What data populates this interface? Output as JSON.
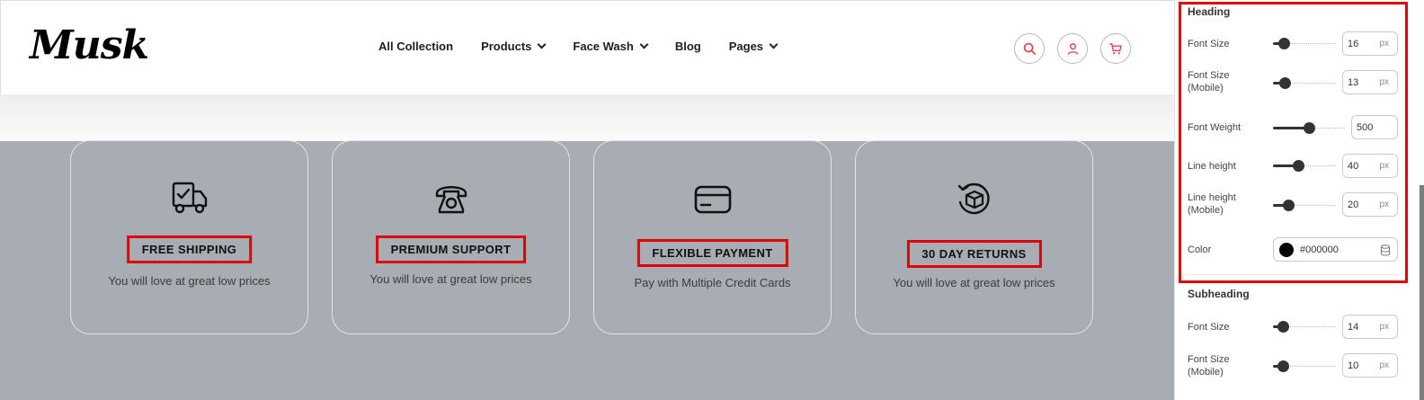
{
  "header": {
    "logo": "Musk",
    "nav": [
      {
        "label": "All Collection",
        "dropdown": false
      },
      {
        "label": "Products",
        "dropdown": true
      },
      {
        "label": "Face Wash",
        "dropdown": true
      },
      {
        "label": "Blog",
        "dropdown": false
      },
      {
        "label": "Pages",
        "dropdown": true
      }
    ],
    "icons": [
      "search-icon",
      "user-icon",
      "cart-icon"
    ],
    "icon_color": "#d9474f"
  },
  "features": [
    {
      "icon": "truck-icon",
      "title": "FREE SHIPPING",
      "subtitle": "You will love at great low prices"
    },
    {
      "icon": "phone-icon",
      "title": "PREMIUM SUPPORT",
      "subtitle": "You will love at great low prices"
    },
    {
      "icon": "credit-card-icon",
      "title": "FLEXIBLE PAYMENT",
      "subtitle": "Pay with Multiple Credit Cards"
    },
    {
      "icon": "return-box-icon",
      "title": "30 DAY RETURNS",
      "subtitle": "You will love at great low prices"
    }
  ],
  "panel": {
    "heading": {
      "title": "Heading",
      "font_size": {
        "label": "Font Size",
        "value": "16",
        "unit": "px"
      },
      "font_size_mobile": {
        "label": "Font Size (Mobile)",
        "value": "13",
        "unit": "px"
      },
      "font_weight": {
        "label": "Font Weight",
        "value": "500"
      },
      "line_height": {
        "label": "Line height",
        "value": "40",
        "unit": "px"
      },
      "line_height_mobile": {
        "label": "Line height (Mobile)",
        "value": "20",
        "unit": "px"
      },
      "color": {
        "label": "Color",
        "value": "#000000"
      }
    },
    "subheading": {
      "title": "Subheading",
      "font_size": {
        "label": "Font Size",
        "value": "14",
        "unit": "px"
      },
      "font_size_mobile": {
        "label": "Font Size (Mobile)",
        "value": "10",
        "unit": "px"
      }
    }
  },
  "colors": {
    "highlight": "#e00000",
    "preview_bg": "#a7adb2"
  }
}
